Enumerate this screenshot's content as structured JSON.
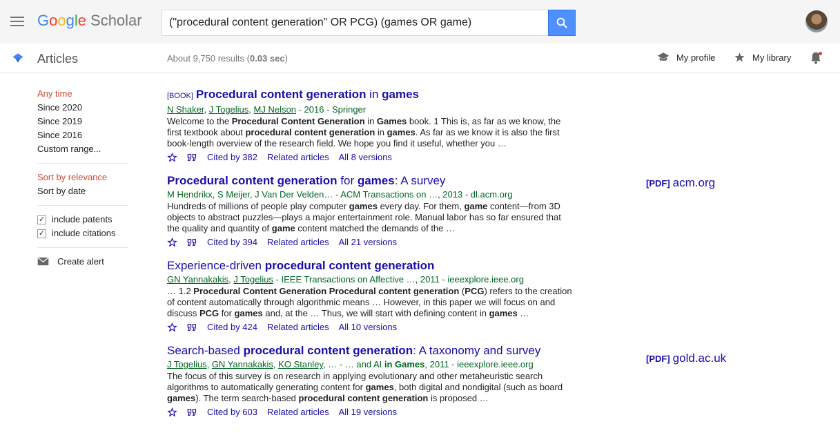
{
  "header": {
    "logo_google": [
      "G",
      "o",
      "o",
      "g",
      "l",
      "e"
    ],
    "logo_scholar": "Scholar",
    "search_value": "(\"procedural content generation\" OR PCG) (games OR game)"
  },
  "subbar": {
    "section": "Articles",
    "result_prefix": "About 9,750 results (",
    "result_time": "0.03 sec",
    "result_suffix": ")",
    "my_profile": "My profile",
    "my_library": "My library"
  },
  "sidebar": {
    "time_filters": [
      "Any time",
      "Since 2020",
      "Since 2019",
      "Since 2016",
      "Custom range..."
    ],
    "sort_options": [
      "Sort by relevance",
      "Sort by date"
    ],
    "checks": [
      "include patents",
      "include citations"
    ],
    "create_alert": "Create alert"
  },
  "results": [
    {
      "tag": "[BOOK]",
      "title_parts": [
        [
          "b",
          "Procedural content generation"
        ],
        [
          "t",
          " in "
        ],
        [
          "b",
          "games"
        ]
      ],
      "authors_links": [
        "N Shaker",
        "J Togelius",
        "MJ Nelson"
      ],
      "authors_rest": " - 2016 - Springer",
      "snippet_html": "Welcome to the <b>Procedural Content Generation</b> in <b>Games</b> book. 1 This is, as far as we know, the first textbook about <b>procedural content generation</b> in <b>games</b>. As far as we know it is also the first book-length overview of the research field. We hope you find it useful, whether you …",
      "cited": "Cited by 382",
      "related": "Related articles",
      "versions": "All 8 versions"
    },
    {
      "tag": "",
      "title_parts": [
        [
          "b",
          "Procedural content generation"
        ],
        [
          "t",
          " for "
        ],
        [
          "b",
          "games"
        ],
        [
          "t",
          ": A survey"
        ]
      ],
      "authors_links": [],
      "authors_rest": "M Hendrikx, S Meijer, J Van Der Velden… - ACM Transactions on …, 2013 - dl.acm.org",
      "snippet_html": "Hundreds of millions of people play computer <b>games</b> every day. For them, <b>game</b> content—from 3D objects to abstract puzzles—plays a major entertainment role. Manual labor has so far ensured that the quality and quantity of <b>game</b> content matched the demands of the …",
      "cited": "Cited by 394",
      "related": "Related articles",
      "versions": "All 21 versions",
      "pdf_tag": "[PDF]",
      "pdf_source": "acm.org"
    },
    {
      "tag": "",
      "title_parts": [
        [
          "t",
          "Experience-driven "
        ],
        [
          "b",
          "procedural content generation"
        ]
      ],
      "authors_links": [
        "GN Yannakakis",
        "J Togelius"
      ],
      "authors_rest": " - IEEE Transactions on Affective …, 2011 - ieeexplore.ieee.org",
      "snippet_html": "… 1.2 <b>Procedural Content Generation Procedural content generation</b> (<b>PCG</b>) refers to the creation of content automatically through algorithmic means … However, in this paper we will focus on and discuss <b>PCG</b> for <b>games</b> and, at the … Thus, we will start with defining content in <b>games</b> …",
      "cited": "Cited by 424",
      "related": "Related articles",
      "versions": "All 10 versions"
    },
    {
      "tag": "",
      "title_parts": [
        [
          "t",
          "Search-based "
        ],
        [
          "b",
          "procedural content generation"
        ],
        [
          "t",
          ": A taxonomy and survey"
        ]
      ],
      "authors_links": [
        "J Togelius",
        "GN Yannakakis",
        "KO Stanley"
      ],
      "authors_rest": "… - … and AI <b>in Games</b>, 2011 - ieeexplore.ieee.org",
      "snippet_html": "The focus of this survey is on research in applying evolutionary and other metaheuristic search algorithms to automatically generating content for <b>games</b>, both digital and nondigital (such as board <b>games</b>). The term search-based <b>procedural content generation</b> is proposed …",
      "cited": "Cited by 603",
      "related": "Related articles",
      "versions": "All 19 versions",
      "pdf_tag": "[PDF]",
      "pdf_source": "gold.ac.uk"
    }
  ],
  "colors": {
    "link": "#1a0dab",
    "author": "#006621",
    "accent_red": "#d14836",
    "search_button": "#4d90fe"
  }
}
